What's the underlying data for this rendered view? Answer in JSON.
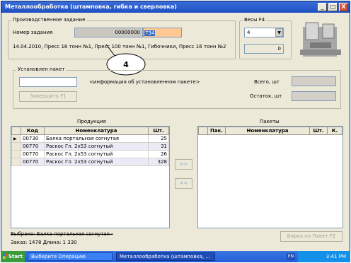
{
  "window": {
    "title": "Металлообработка (штамповка, гибка и сверловка)",
    "controls": [
      "_",
      "□",
      "X"
    ]
  },
  "job": {
    "group_label": "Производственное задание",
    "number_label": "Номер задания",
    "number_value": "00000000",
    "number_input": "734",
    "description": "14.04.2010, Пресс 16 тонн №1, Пресс 100 тонн №1, Гибочники, Пресс 16 тонн №2"
  },
  "scales": {
    "group_label": "Весы F4",
    "selected": "4",
    "reading": "0"
  },
  "callout": "4",
  "package": {
    "group_label": "Установлен пакет",
    "info": "<информация об установленном пакете>",
    "finish_button": "Завершить   F1",
    "total_label": "Всего, шт",
    "remainder_label": "Остаток, шт"
  },
  "products": {
    "title": "Продукция",
    "columns": [
      "Код",
      "Номенклатура",
      "Шт."
    ],
    "rows": [
      {
        "code": "00730",
        "name": "Балка портальная согнутая",
        "qty": "25"
      },
      {
        "code": "00770",
        "name": "Раскос Гл. 2х53 согнутый",
        "qty": "31"
      },
      {
        "code": "00770",
        "name": "Раскос Гл. 2х53 согнутый",
        "qty": "26"
      },
      {
        "code": "00770",
        "name": "Раскос Гл. 2х53 согнутый",
        "qty": "328"
      }
    ]
  },
  "transfer": {
    "right": ">>",
    "left": "<<"
  },
  "packages": {
    "title": "Пакеты",
    "columns": [
      "Пак.",
      "Номенклатура",
      "Шт.",
      "К."
    ]
  },
  "footer": {
    "selected": "Выбрано: Балка портальная согнутая -",
    "order": "Заказ: 1478  Длина: 1 330",
    "weigh_button": "Бирка на Пакет   F2"
  },
  "taskbar": {
    "start": "Start",
    "task1": "Выберите Операцию",
    "task2": "Металлообработка (штамповка, ...",
    "lang": "EN",
    "time": "3:41 PM"
  },
  "colors": {
    "title_bar": "#245edb",
    "highlight_input": "#ffc894",
    "selection": "#316ac5"
  }
}
